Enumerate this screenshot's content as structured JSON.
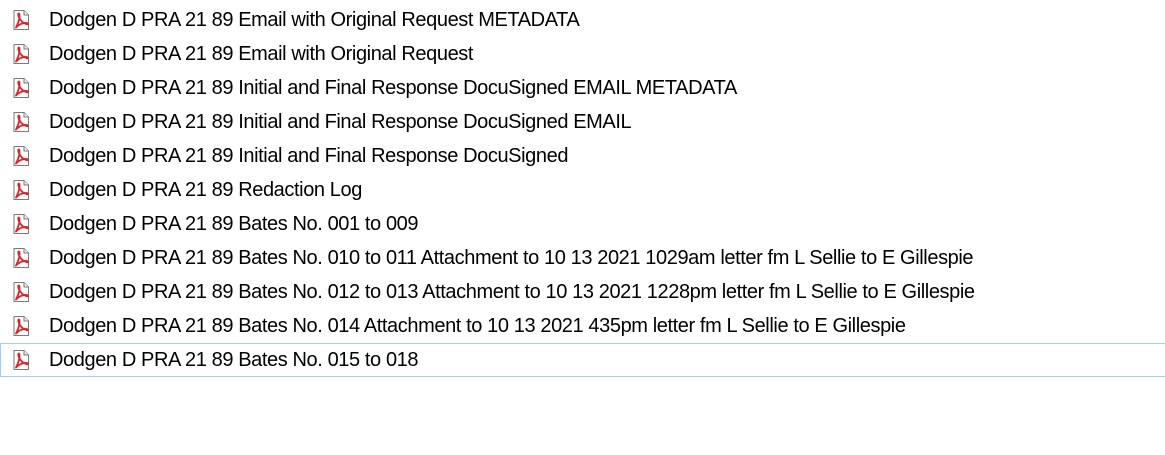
{
  "files": [
    {
      "name": "Dodgen D PRA 21 89 Email with Original Request METADATA",
      "icon": "pdf-file-icon"
    },
    {
      "name": "Dodgen D PRA 21 89 Email with Original Request",
      "icon": "pdf-file-icon"
    },
    {
      "name": "Dodgen D PRA 21 89 Initial and Final Response DocuSigned EMAIL METADATA",
      "icon": "pdf-file-icon"
    },
    {
      "name": "Dodgen D PRA 21 89 Initial and Final Response DocuSigned EMAIL",
      "icon": "pdf-file-icon"
    },
    {
      "name": "Dodgen D PRA 21 89 Initial and Final Response DocuSigned",
      "icon": "pdf-file-icon"
    },
    {
      "name": "Dodgen D PRA 21 89 Redaction Log",
      "icon": "pdf-file-icon"
    },
    {
      "name": "Dodgen D PRA 21 89 Bates No. 001 to 009",
      "icon": "pdf-file-icon"
    },
    {
      "name": "Dodgen D PRA 21 89 Bates No. 010 to 011 Attachment to 10 13 2021 1029am letter fm L Sellie to E Gillespie",
      "icon": "pdf-file-icon"
    },
    {
      "name": "Dodgen D PRA 21 89 Bates No. 012 to 013 Attachment to 10 13 2021 1228pm letter fm L Sellie to E Gillespie",
      "icon": "pdf-file-icon"
    },
    {
      "name": "Dodgen D PRA 21 89 Bates No. 014 Attachment to 10 13 2021 435pm letter fm L Sellie to E Gillespie",
      "icon": "pdf-file-icon"
    },
    {
      "name": "Dodgen D PRA 21 89 Bates No. 015 to 018",
      "icon": "pdf-file-icon"
    }
  ],
  "colors": {
    "pdf_red": "#d7262b",
    "page_white": "#ffffff",
    "page_border": "#7a7a7a",
    "focus_border": "#99d1ff"
  }
}
